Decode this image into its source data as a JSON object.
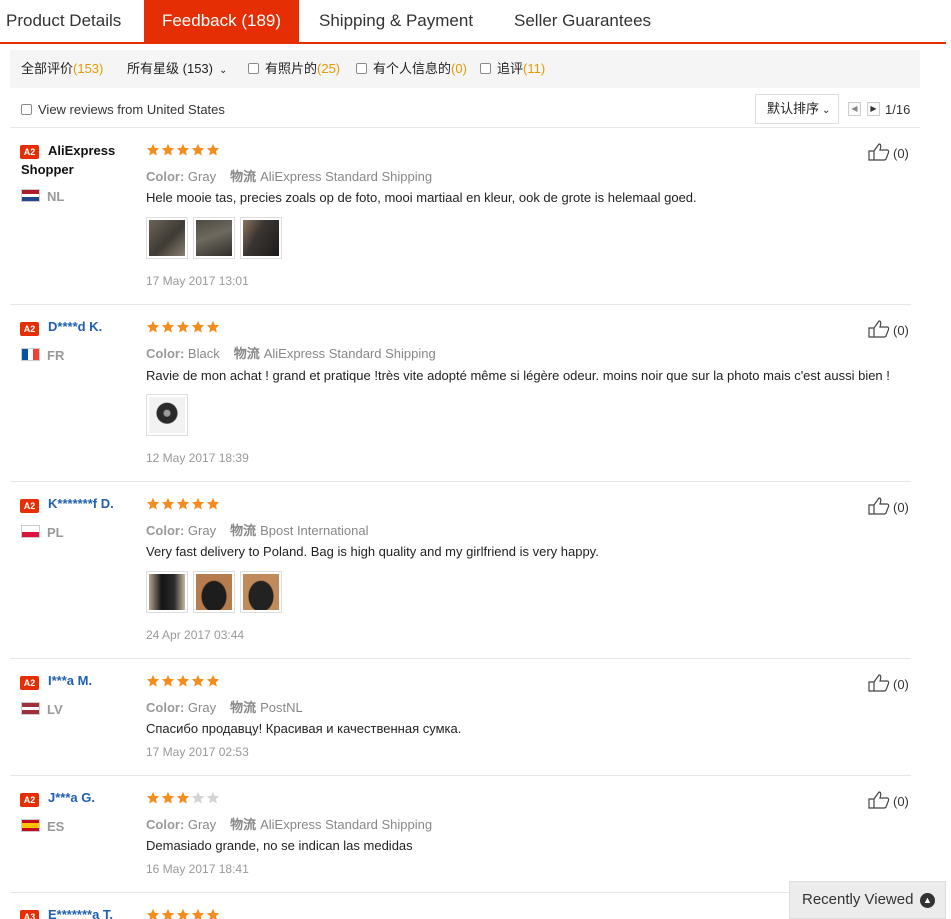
{
  "tabs": [
    {
      "label": "Product Details"
    },
    {
      "label": "Feedback (189)"
    },
    {
      "label": "Shipping & Payment"
    },
    {
      "label": "Seller Guarantees"
    }
  ],
  "filters": {
    "all": {
      "label": "全部评价",
      "count": "(153)"
    },
    "stars": {
      "label": "所有星级",
      "count": "(153)"
    },
    "photos": {
      "label": "有照片的",
      "count": "(25)"
    },
    "personal": {
      "label": "有个人信息的",
      "count": "(0)"
    },
    "additional": {
      "label": "追评",
      "count": "(11)"
    }
  },
  "subbar": {
    "us_filter_label": "View reviews from United States",
    "sort_label": "默认排序",
    "page": "1/16"
  },
  "colors": {
    "accent": "#e62e04",
    "star": "#f58c1e",
    "link": "#2060b0"
  },
  "reviews": [
    {
      "badge": "A2",
      "name": "AliExpress Shopper",
      "country": "NL",
      "rating": 5,
      "color_label": "Color:",
      "color": "Gray",
      "shipping_label": "物流",
      "shipping": "AliExpress Standard Shipping",
      "text": "Hele mooie tas, precies zoals op de foto, mooi martiaal en kleur, ook de grote is helemaal goed.",
      "photo_count": 3,
      "date": "17 May 2017 13:01",
      "likes": "(0)"
    },
    {
      "badge": "A2",
      "name": "D****d K.",
      "country": "FR",
      "rating": 5,
      "color_label": "Color:",
      "color": "Black",
      "shipping_label": "物流",
      "shipping": "AliExpress Standard Shipping",
      "text": "Ravie de mon achat ! grand et pratique !très vite adopté même si légère odeur. moins noir que sur la photo mais c'est aussi bien !",
      "photo_count": 1,
      "date": "12 May 2017 18:39",
      "likes": "(0)"
    },
    {
      "badge": "A2",
      "name": "K*******f D.",
      "country": "PL",
      "rating": 5,
      "color_label": "Color:",
      "color": "Gray",
      "shipping_label": "物流",
      "shipping": "Bpost International",
      "text": "Very fast delivery to Poland. Bag is high quality and my girlfriend is very happy.",
      "photo_count": 3,
      "date": "24 Apr 2017 03:44",
      "likes": "(0)"
    },
    {
      "badge": "A2",
      "name": "I***a M.",
      "country": "LV",
      "rating": 5,
      "color_label": "Color:",
      "color": "Gray",
      "shipping_label": "物流",
      "shipping": "PostNL",
      "text": "Спасибо продавцу! Красивая и качественная сумка.",
      "photo_count": 0,
      "date": "17 May 2017 02:53",
      "likes": "(0)"
    },
    {
      "badge": "A2",
      "name": "J***a G.",
      "country": "ES",
      "rating": 3,
      "color_label": "Color:",
      "color": "Gray",
      "shipping_label": "物流",
      "shipping": "AliExpress Standard Shipping",
      "text": "Demasiado grande, no se indican las medidas",
      "photo_count": 0,
      "date": "16 May 2017 18:41",
      "likes": "(0)"
    },
    {
      "badge": "A3",
      "name": "E*******a T.",
      "rating": 5
    }
  ],
  "recently_viewed": {
    "label": "Recently Viewed",
    "icon": "chevron-up-circle-icon"
  }
}
